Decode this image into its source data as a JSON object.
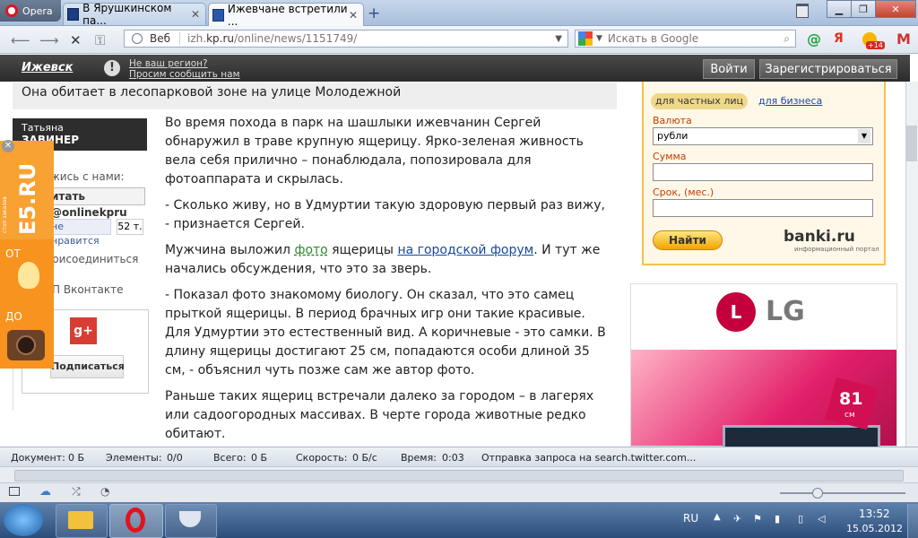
{
  "browser": {
    "menu_label": "Opera",
    "tabs": [
      {
        "title": "В Ярушкинском па..."
      },
      {
        "title": "Ижевчане встретили ..."
      }
    ],
    "address": {
      "mode": "Веб",
      "host": "izh.",
      "host_bold": "kp.ru",
      "path": "/online/news/1151749/"
    },
    "search_placeholder": "Искать в Google",
    "badge": "+14"
  },
  "site_header": {
    "city": "Ижевск",
    "region_line1": "Не ваш регион?",
    "region_line2": "Просим сообщить нам",
    "login": "Войти",
    "register": "Зарегистрироваться"
  },
  "article": {
    "subtitle": "Она обитает в лесопарковой зоне на улице Молодежной",
    "p1": "Во время похода в парк на шашлыки ижевчанин Сергей обнаружил в траве крупную ящерицу. Ярко-зеленая живность вела себя прилично – понаблюдала, попозировала для фотоаппарата и скрылась.",
    "p2": "- Сколько живу, но в Удмуртии такую здоровую первый раз вижу, - признается Сергей.",
    "p3_a": "Мужчина выложил ",
    "p3_link1": "фото",
    "p3_b": " ящерицы ",
    "p3_link2": "на городской форум",
    "p3_c": ". И тут же начались обсуждения, что это за зверь.",
    "p4": "- Показал фото знакомому биологу. Он сказал, что это самец прыткой ящерицы. В период брачных игр они такие красивые. Для Удмуртии это естественный вид. А коричневые - это самки. В длину ящерицы достигают 25 см, попадаются особи длиной 35 см, - объяснил чуть позже сам же автор фото.",
    "p5": "Раньше таких ящериц встречали далеко за городом – в лагерях или садоогородных массивах. В черте города животные редко обитают."
  },
  "sidebar": {
    "author_first": "Татьяна",
    "author_last": "ЗАВИНЕР",
    "follow": "жись с нами:",
    "twitter": "итать @onlinekpru",
    "like": "не нравится",
    "like_count": "52 т.",
    "join": "рисоединиться",
    "vk": "П Вконтакте",
    "subscribe": "Подписаться"
  },
  "e5_ad": {
    "logo": "E5.RU",
    "tagline": "стоп заказов",
    "from": "ОТ",
    "to": "ДО"
  },
  "bank_widget": {
    "tab_private": "для частных лиц",
    "tab_business": "для бизнеса",
    "currency_label": "Валюта",
    "currency_value": "рубли",
    "sum_label": "Сумма",
    "term_label": "Срок, (мес.)",
    "find_button": "Найти",
    "logo": "banki.ru",
    "logo_sub": "информационный портал"
  },
  "lg_ad": {
    "brand": "LG",
    "size": "81",
    "unit": "см"
  },
  "statusbar": {
    "doc_label": "Документ:",
    "doc_value": "0 Б",
    "elements_label": "Элементы:",
    "elements_value": "0/0",
    "total_label": "Всего:",
    "total_value": "0 Б",
    "speed_label": "Скорость:",
    "speed_value": "0 Б/с",
    "time_label": "Время:",
    "time_value": "0:03",
    "message": "Отправка запроса на search.twitter.com..."
  },
  "taskbar": {
    "lang": "RU",
    "time": "13:52",
    "date": "15.05.2012"
  },
  "colors": {
    "kp_dark": "#2c2c2c",
    "link": "#17499a",
    "bank_orange": "#f4c24a",
    "e5_orange": "#f7931e"
  }
}
